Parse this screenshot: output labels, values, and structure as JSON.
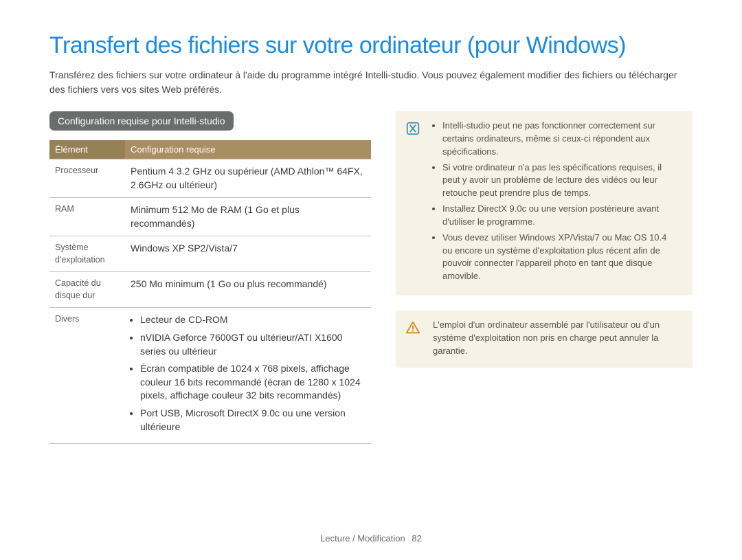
{
  "title": "Transfert des fichiers sur votre ordinateur (pour Windows)",
  "intro": "Transférez des fichiers sur votre ordinateur à l'aide du programme intégré Intelli-studio. Vous pouvez également modifier des fichiers ou télécharger des fichiers vers vos sites Web préférés.",
  "section_heading": "Configuration requise pour Intelli-studio",
  "table": {
    "head": {
      "c1": "Élément",
      "c2": "Configuration requise"
    },
    "rows": {
      "cpu": {
        "k": "Processeur",
        "v": "Pentium 4 3.2 GHz ou supérieur\n(AMD Athlon™ 64FX, 2.6GHz ou ultérieur)"
      },
      "ram": {
        "k": "RAM",
        "v": "Minimum 512 Mo de RAM\n(1 Go et plus recommandés)"
      },
      "os": {
        "k": "Système d'exploitation",
        "v": "Windows XP SP2/Vista/7"
      },
      "hdd": {
        "k": "Capacité du disque dur",
        "v": "250 Mo minimum (1 Go ou plus recommandé)"
      },
      "other": {
        "k": "Divers",
        "items": {
          "i1": "Lecteur de CD-ROM",
          "i2": "nVIDIA Geforce 7600GT ou ultérieur/ATI X1600 series ou ultérieur",
          "i3": "Écran compatible de 1024 x 768 pixels, affichage couleur 16 bits recommandé (écran de 1280 x 1024 pixels, affichage couleur 32 bits recommandés)",
          "i4": "Port USB, Microsoft DirectX 9.0c ou une version ultérieure"
        }
      }
    }
  },
  "info_note": {
    "n1": "Intelli-studio peut ne pas fonctionner correctement sur certains ordinateurs, même si ceux-ci répondent aux spécifications.",
    "n2": "Si votre ordinateur n'a pas les spécifications requises, il peut y avoir un problème de lecture des vidéos ou leur retouche peut prendre plus de temps.",
    "n3": "Installez DirectX 9.0c ou une version postérieure avant d'utiliser le programme.",
    "n4": "Vous devez utiliser Windows XP/Vista/7 ou Mac OS 10.4 ou encore un système d'exploitation plus récent afin de pouvoir connecter l'appareil photo en tant que disque amovible."
  },
  "warn_note": "L'emploi d'un ordinateur assemblé par l'utilisateur ou d'un système d'exploitation non pris en charge peut annuler la garantie.",
  "footer": {
    "section": "Lecture / Modification",
    "page": "82"
  }
}
